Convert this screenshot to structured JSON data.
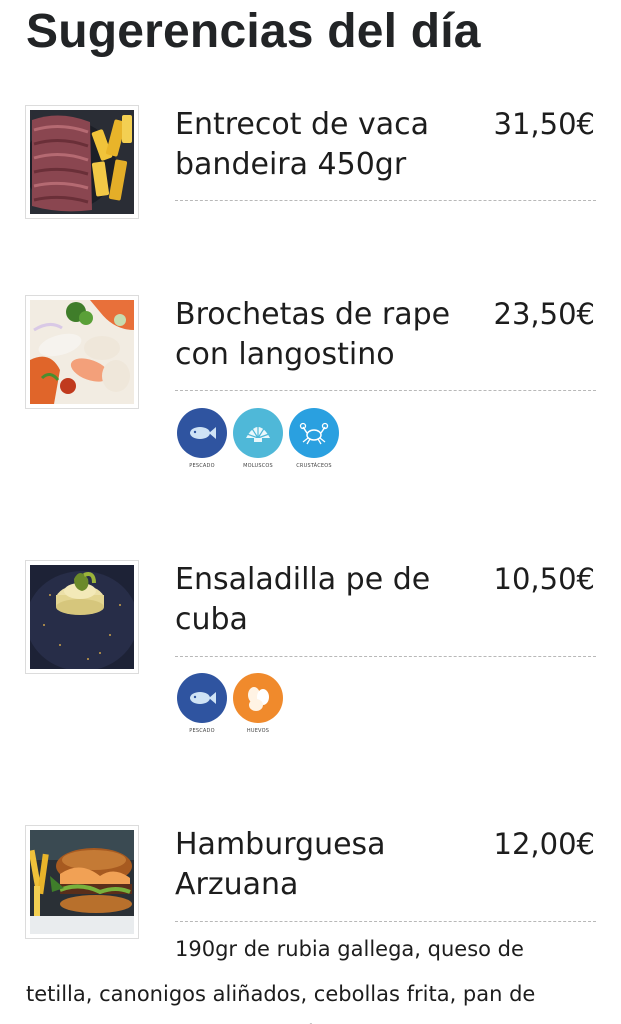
{
  "page": {
    "title": "Sugerencias del día"
  },
  "items": [
    {
      "name": "Entrecot de vaca bandeira 450gr",
      "price": "31,50€",
      "image": "steak-with-fries-photo"
    },
    {
      "name": "Brochetas de rape con langostino",
      "price": "23,50€",
      "image": "monkfish-prawn-skewers-photo",
      "allergens": [
        {
          "label": "PESCADO",
          "icon": "fish-icon",
          "color": "#2f54a0"
        },
        {
          "label": "MOLUSCOS",
          "icon": "shell-icon",
          "color": "#4fb8d8"
        },
        {
          "label": "CRUSTÁCEOS",
          "icon": "crab-icon",
          "color": "#2aa0e0"
        }
      ]
    },
    {
      "name": "Ensaladilla pe de cuba",
      "price": "10,50€",
      "image": "russian-salad-photo",
      "allergens": [
        {
          "label": "PESCADO",
          "icon": "fish-icon",
          "color": "#2f54a0"
        },
        {
          "label": "HUEVOS",
          "icon": "eggs-icon",
          "color": "#f08a2c"
        }
      ]
    },
    {
      "name": "Hamburguesa Arzuana",
      "price": "12,00€",
      "image": "burger-photo",
      "description_first_line": "190gr de rubia gallega, queso de",
      "description_rest": "tetilla, canonigos aliñados, cebollas frita, pan de brioche con semillas de chía, lino y sustra..."
    }
  ]
}
